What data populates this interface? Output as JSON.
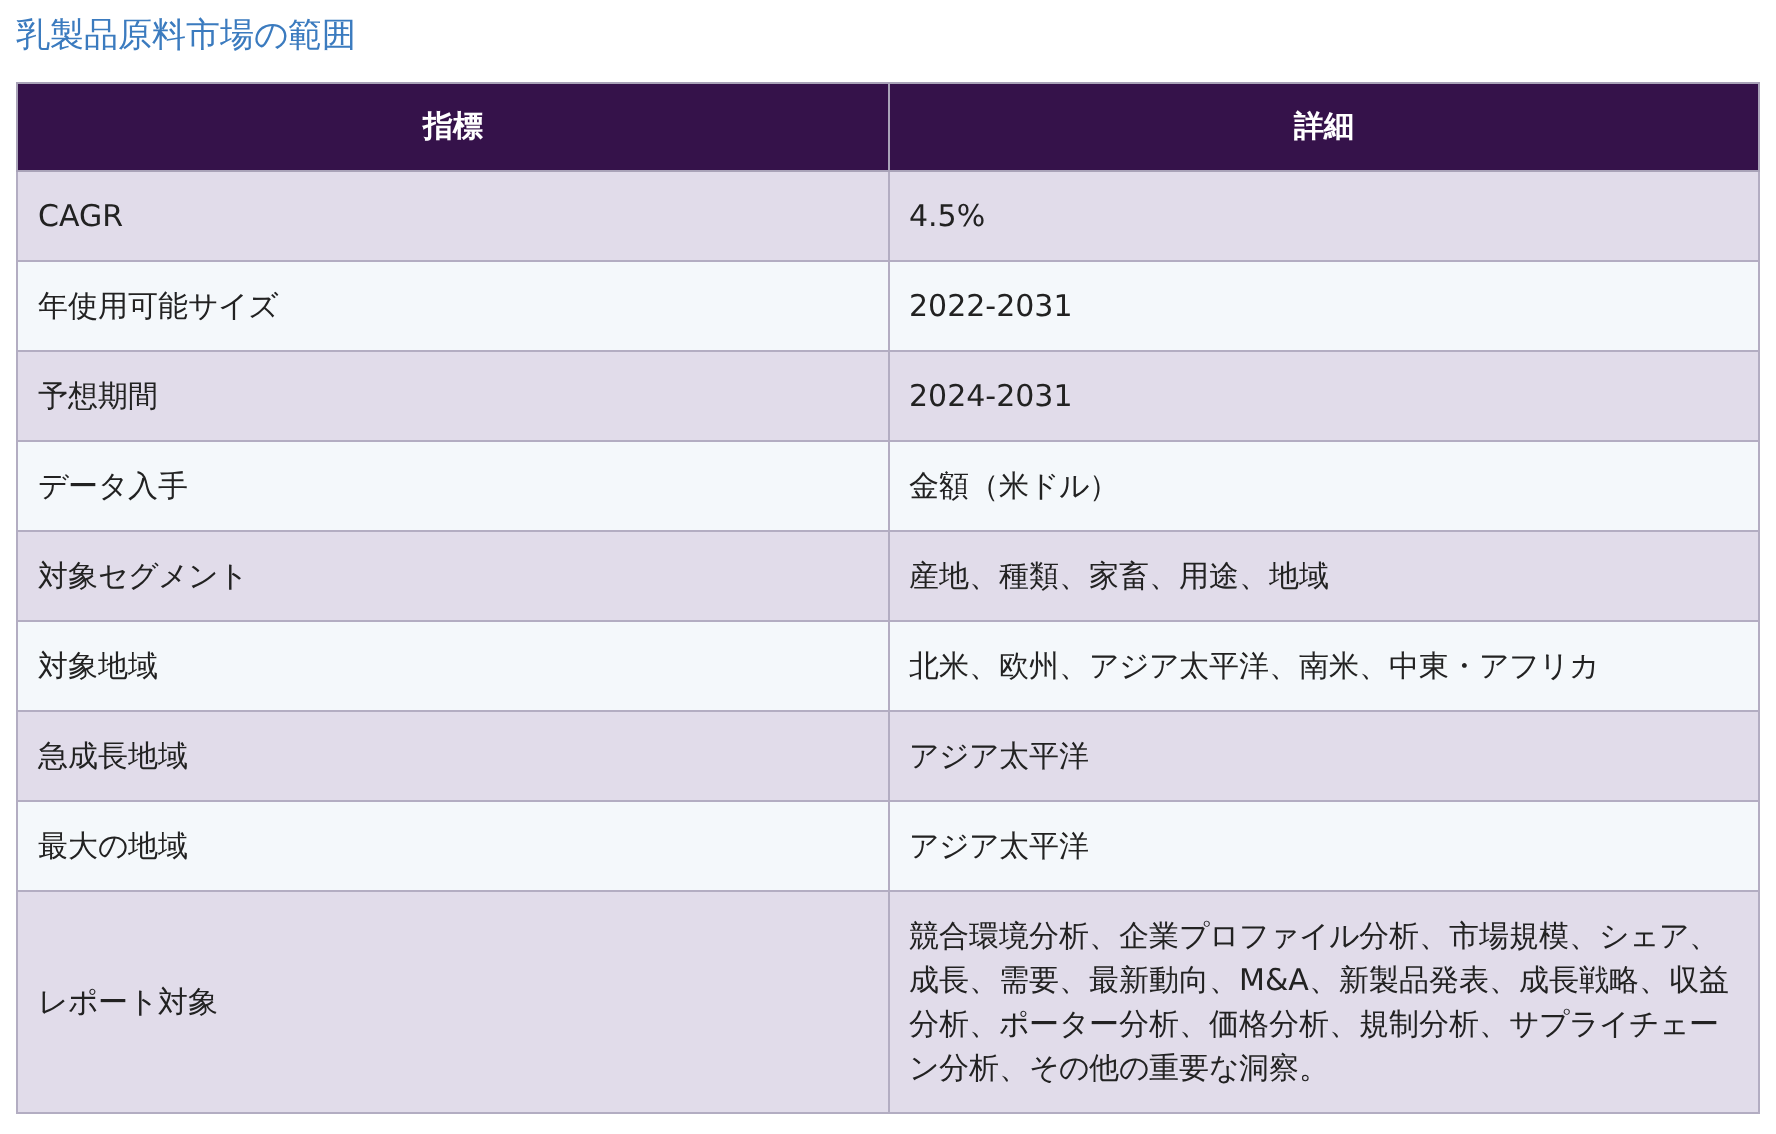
{
  "title": "乳製品原料市場の範囲",
  "table": {
    "columns": [
      "指標",
      "詳細"
    ],
    "rows": [
      {
        "metric": "CAGR",
        "detail": "4.5%"
      },
      {
        "metric": "年使用可能サイズ",
        "detail": "2022-2031"
      },
      {
        "metric": "予想期間",
        "detail": "2024-2031"
      },
      {
        "metric": "データ入手",
        "detail": "金額（米ドル）"
      },
      {
        "metric": "対象セグメント",
        "detail": "産地、種類、家畜、用途、地域"
      },
      {
        "metric": "対象地域",
        "detail": "北米、欧州、アジア太平洋、南米、中東・アフリカ"
      },
      {
        "metric": "急成長地域",
        "detail": "アジア太平洋"
      },
      {
        "metric": "最大の地域",
        "detail": "アジア太平洋"
      },
      {
        "metric": "レポート対象",
        "detail": "競合環境分析、企業プロファイル分析、市場規模、シェア、成長、需要、最新動向、M&A、新製品発表、成長戦略、収益分析、ポーター分析、価格分析、規制分析、サプライチェーン分析、その他の重要な洞察。"
      }
    ]
  }
}
